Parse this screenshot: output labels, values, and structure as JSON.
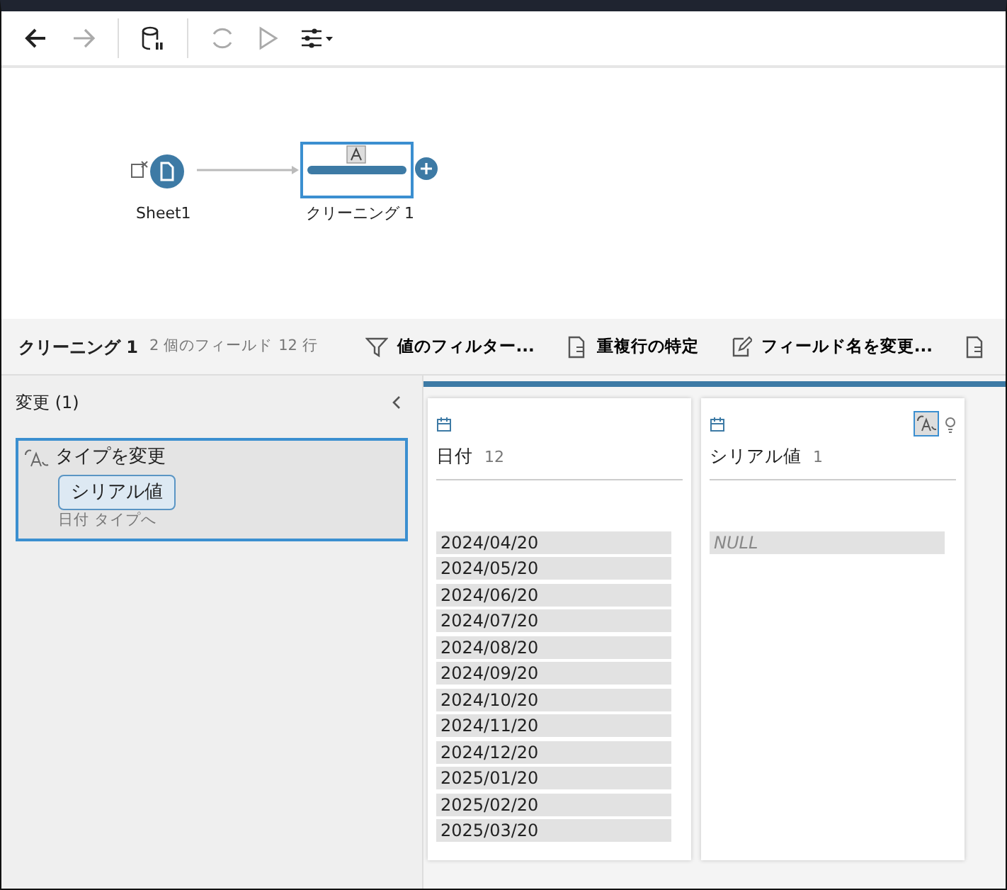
{
  "toolbar": [
    {
      "kind": "back",
      "disabled": false
    },
    {
      "kind": "forward",
      "disabled": true
    },
    {
      "kind": "database",
      "disabled": false
    },
    {
      "kind": "refresh",
      "disabled": true
    },
    {
      "kind": "run",
      "disabled": true
    },
    {
      "kind": "settings",
      "disabled": false
    }
  ],
  "flow": {
    "nodes": [
      {
        "kind": "input",
        "label": "Sheet1",
        "selected": false
      },
      {
        "kind": "clean",
        "label": "クリーニング 1",
        "selected": true
      }
    ]
  },
  "step_bar": {
    "title": "クリーニング 1",
    "fields": "2 個のフィールド",
    "rows": "12 行",
    "actions": [
      {
        "kind": "filter",
        "label": "値のフィルター..."
      },
      {
        "kind": "doc",
        "label": "重複行の特定"
      },
      {
        "kind": "edit",
        "label": "フィールド名を変更..."
      },
      {
        "kind": "doc"
      }
    ]
  },
  "changes": {
    "title": "変更 (1)",
    "items": [
      {
        "title": "タイプを変更",
        "field": "シリアル値",
        "detail": "日付 タイプへ",
        "selected": true
      }
    ]
  },
  "profile": [
    {
      "name": "日付",
      "count": "12",
      "recommendation": false,
      "values": [
        {
          "text": "2024/04/20",
          "null": false
        },
        {
          "text": "2024/05/20",
          "null": false
        },
        {
          "text": "2024/06/20",
          "null": false
        },
        {
          "text": "2024/07/20",
          "null": false
        },
        {
          "text": "2024/08/20",
          "null": false
        },
        {
          "text": "2024/09/20",
          "null": false
        },
        {
          "text": "2024/10/20",
          "null": false
        },
        {
          "text": "2024/11/20",
          "null": false
        },
        {
          "text": "2024/12/20",
          "null": false
        },
        {
          "text": "2025/01/20",
          "null": false
        },
        {
          "text": "2025/02/20",
          "null": false
        },
        {
          "text": "2025/03/20",
          "null": false
        }
      ]
    },
    {
      "name": "シリアル値",
      "count": "1",
      "recommendation": true,
      "values": [
        {
          "text": "NULL",
          "null": true
        }
      ]
    }
  ]
}
